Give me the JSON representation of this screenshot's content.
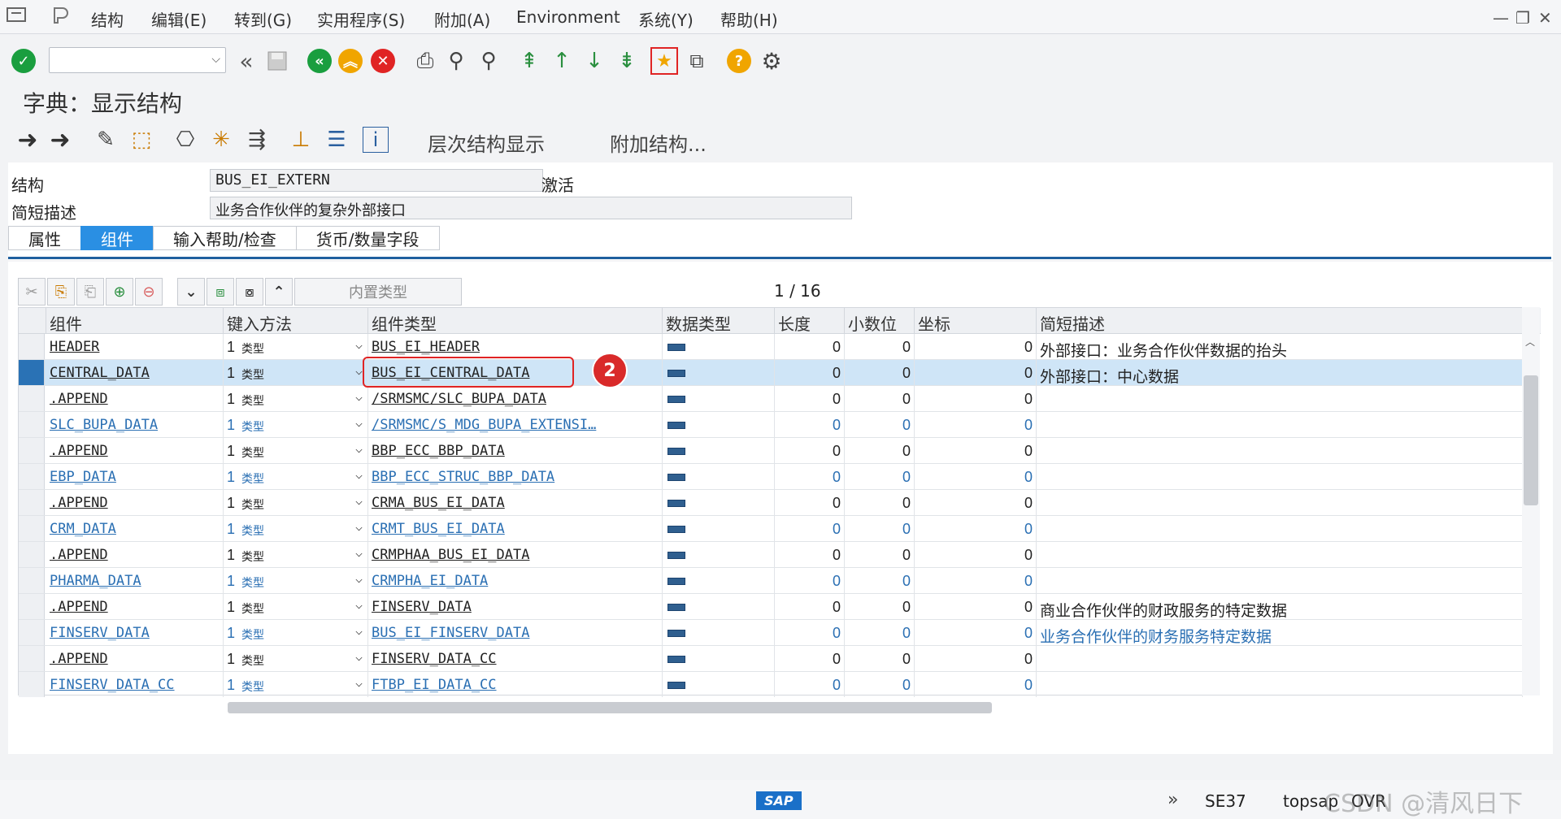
{
  "menu": {
    "items": [
      "结构",
      "编辑(E)",
      "转到(G)",
      "实用程序(S)",
      "附加(A)",
      "Environment",
      "系统(Y)",
      "帮助(H)"
    ]
  },
  "window": {
    "title": "字典：显示结构"
  },
  "app_toolbar": {
    "hierarchy_label": "层次结构显示",
    "append_label": "附加结构..."
  },
  "form": {
    "struct_label": "结构",
    "struct_value": "BUS_EI_EXTERN",
    "status": "激活",
    "desc_label": "简短描述",
    "desc_value": "业务合作伙伴的复杂外部接口"
  },
  "tabs": [
    {
      "label": "属性"
    },
    {
      "label": "组件"
    },
    {
      "label": "输入帮助/检查"
    },
    {
      "label": "货币/数量字段"
    }
  ],
  "table_toolbar": {
    "builtin_type": "内置类型"
  },
  "pager": {
    "text": "1  /  16"
  },
  "columns": [
    "组件",
    "键入方法",
    "组件类型",
    "数据类型",
    "长度",
    "小数位",
    "坐标",
    "简短描述"
  ],
  "rows": [
    {
      "comp": "HEADER",
      "m1": "1",
      "m2": "类型",
      "type": "BUS_EI_HEADER",
      "len": "0",
      "dec": "0",
      "coord": "0",
      "desc": "外部接口：业务合作伙伴数据的抬头",
      "link": false,
      "sel": false
    },
    {
      "comp": "CENTRAL_DATA",
      "m1": "1",
      "m2": "类型",
      "type": "BUS_EI_CENTRAL_DATA",
      "len": "0",
      "dec": "0",
      "coord": "0",
      "desc": "外部接口：中心数据",
      "link": false,
      "sel": true
    },
    {
      "comp": ".APPEND",
      "m1": "1",
      "m2": "类型",
      "type": "/SRMSMC/SLC_BUPA_DATA",
      "len": "0",
      "dec": "0",
      "coord": "0",
      "desc": "",
      "link": false,
      "sel": false
    },
    {
      "comp": "SLC_BUPA_DATA",
      "m1": "1",
      "m2": "类型",
      "type": "/SRMSMC/S_MDG_BUPA_EXTENSI…",
      "len": "0",
      "dec": "0",
      "coord": "0",
      "desc": "",
      "link": true,
      "sel": false
    },
    {
      "comp": ".APPEND",
      "m1": "1",
      "m2": "类型",
      "type": "BBP_ECC_BBP_DATA",
      "len": "0",
      "dec": "0",
      "coord": "0",
      "desc": "",
      "link": false,
      "sel": false
    },
    {
      "comp": "EBP_DATA",
      "m1": "1",
      "m2": "类型",
      "type": "BBP_ECC_STRUC_BBP_DATA",
      "len": "0",
      "dec": "0",
      "coord": "0",
      "desc": "",
      "link": true,
      "sel": false
    },
    {
      "comp": ".APPEND",
      "m1": "1",
      "m2": "类型",
      "type": "CRMA_BUS_EI_DATA",
      "len": "0",
      "dec": "0",
      "coord": "0",
      "desc": "",
      "link": false,
      "sel": false
    },
    {
      "comp": "CRM_DATA",
      "m1": "1",
      "m2": "类型",
      "type": "CRMT_BUS_EI_DATA",
      "len": "0",
      "dec": "0",
      "coord": "0",
      "desc": "",
      "link": true,
      "sel": false
    },
    {
      "comp": ".APPEND",
      "m1": "1",
      "m2": "类型",
      "type": "CRMPHAA_BUS_EI_DATA",
      "len": "0",
      "dec": "0",
      "coord": "0",
      "desc": "",
      "link": false,
      "sel": false
    },
    {
      "comp": "PHARMA_DATA",
      "m1": "1",
      "m2": "类型",
      "type": "CRMPHA_EI_DATA",
      "len": "0",
      "dec": "0",
      "coord": "0",
      "desc": "",
      "link": true,
      "sel": false
    },
    {
      "comp": ".APPEND",
      "m1": "1",
      "m2": "类型",
      "type": "FINSERV_DATA",
      "len": "0",
      "dec": "0",
      "coord": "0",
      "desc": "商业合作伙伴的财政服务的特定数据",
      "link": false,
      "sel": false
    },
    {
      "comp": "FINSERV_DATA",
      "m1": "1",
      "m2": "类型",
      "type": "BUS_EI_FINSERV_DATA",
      "len": "0",
      "dec": "0",
      "coord": "0",
      "desc": "业务合作伙伴的财务服务特定数据",
      "link": true,
      "sel": false
    },
    {
      "comp": ".APPEND",
      "m1": "1",
      "m2": "类型",
      "type": "FINSERV_DATA_CC",
      "len": "0",
      "dec": "0",
      "coord": "0",
      "desc": "",
      "link": false,
      "sel": false
    },
    {
      "comp": "FINSERV_DATA_CC",
      "m1": "1",
      "m2": "类型",
      "type": "FTBP_EI_DATA_CC",
      "len": "0",
      "dec": "0",
      "coord": "0",
      "desc": "",
      "link": true,
      "sel": false
    }
  ],
  "annotation": {
    "badge": "2"
  },
  "status": {
    "sap_logo": "SAP",
    "tcode": "SE37",
    "server": "topsap",
    "mode": "OVR",
    "watermark": "CSDN @清风日下"
  },
  "colors": {
    "link": "#2a6fb3",
    "accent": "#2a8fe3",
    "selected_row": "#cfe5f7",
    "highlight": "#e02424"
  }
}
